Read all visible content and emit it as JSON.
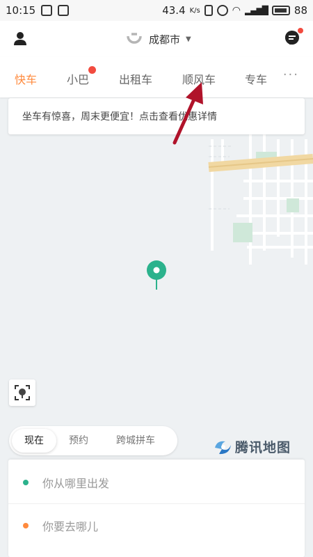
{
  "status_bar": {
    "time": "10:15",
    "network_speed": "43.4",
    "network_unit": "K/s",
    "battery": "88"
  },
  "header": {
    "city": "成都市"
  },
  "tabs": [
    {
      "label": "快车",
      "active": true
    },
    {
      "label": "小巴",
      "active": false,
      "badge": true
    },
    {
      "label": "出租车",
      "active": false
    },
    {
      "label": "顺风车",
      "active": false
    },
    {
      "label": "专车",
      "active": false
    }
  ],
  "more_label": "···",
  "promo": {
    "text": "坐车有惊喜，周末更便宜！点击查看优惠详情"
  },
  "time_selector": {
    "options": [
      "现在",
      "预约",
      "跨城拼车"
    ],
    "selected": "现在"
  },
  "map_provider": "腾讯地图",
  "address": {
    "from_placeholder": "你从哪里出发",
    "to_placeholder": "你要去哪儿"
  },
  "colors": {
    "accent": "#ff8a3d",
    "pickup_dot": "#2bb28c",
    "dest_dot": "#ff8a3d",
    "badge": "#f24b3f",
    "arrow": "#b0132a"
  }
}
